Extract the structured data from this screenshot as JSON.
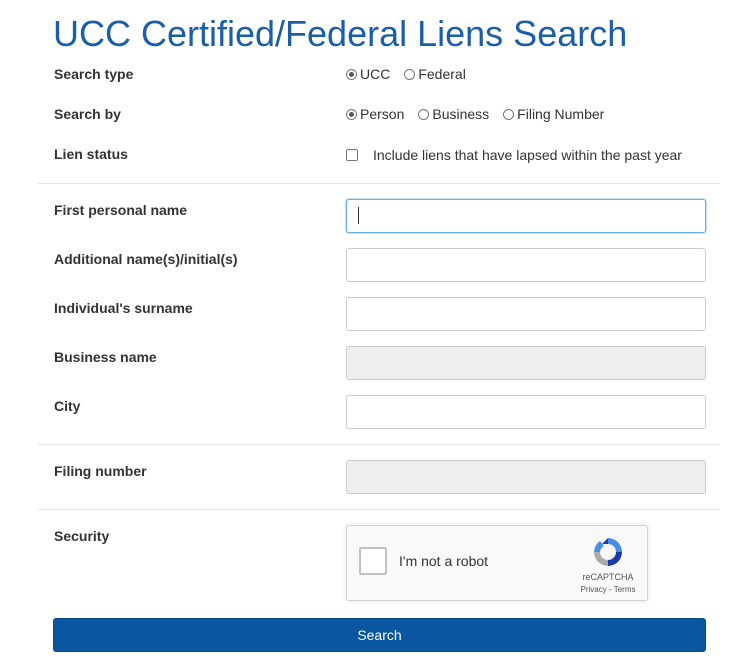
{
  "page": {
    "title": "UCC Certified/Federal Liens Search"
  },
  "search_type": {
    "label": "Search type",
    "options": [
      {
        "label": "UCC",
        "checked": true
      },
      {
        "label": "Federal",
        "checked": false
      }
    ]
  },
  "search_by": {
    "label": "Search by",
    "options": [
      {
        "label": "Person",
        "checked": true
      },
      {
        "label": "Business",
        "checked": false
      },
      {
        "label": "Filing Number",
        "checked": false
      }
    ]
  },
  "lien_status": {
    "label": "Lien status",
    "checkbox_label": "Include liens that have lapsed within the past year",
    "checked": false
  },
  "fields": {
    "first_name": {
      "label": "First personal name",
      "value": "",
      "state": "focused"
    },
    "additional_names": {
      "label": "Additional name(s)/initial(s)",
      "value": "",
      "state": "enabled"
    },
    "surname": {
      "label": "Individual's surname",
      "value": "",
      "state": "enabled"
    },
    "business_name": {
      "label": "Business name",
      "value": "",
      "state": "disabled"
    },
    "city": {
      "label": "City",
      "value": "",
      "state": "enabled"
    },
    "filing_number": {
      "label": "Filing number",
      "value": "",
      "state": "disabled"
    }
  },
  "security": {
    "label": "Security",
    "captcha_text": "I'm not a robot",
    "captcha_brand": "reCAPTCHA",
    "captcha_links": "Privacy - Terms",
    "captcha_icon": "recaptcha-logo-icon"
  },
  "actions": {
    "search_label": "Search"
  },
  "colors": {
    "title": "#1a5ea8",
    "button": "#0a56a0",
    "focus_border": "#66afe9",
    "disabled_bg": "#eeeeee"
  }
}
